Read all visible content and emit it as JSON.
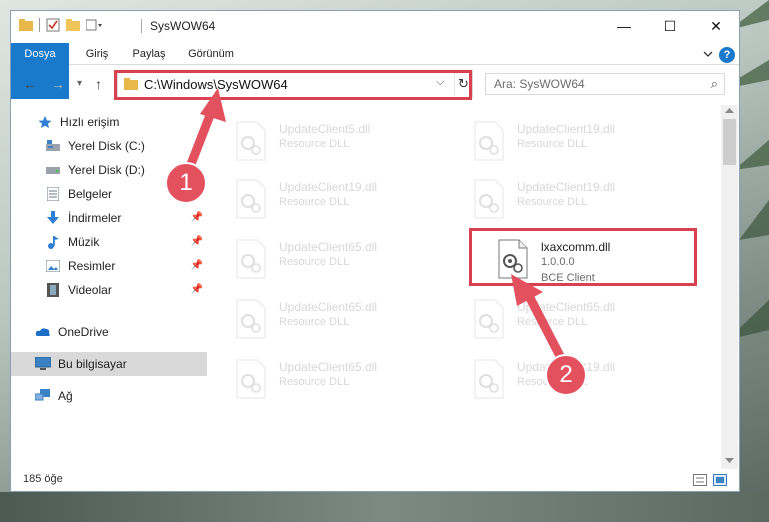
{
  "window": {
    "title": "SysWOW64",
    "controls": {
      "minimize": "—",
      "maximize": "☐",
      "close": "✕"
    }
  },
  "ribbon": {
    "tabs": [
      "Dosya",
      "Giriş",
      "Paylaş",
      "Görünüm"
    ],
    "help": "?"
  },
  "navigation": {
    "back": "←",
    "forward": "→",
    "recent": "▾",
    "up": "↑",
    "address": "C:\\Windows\\SysWOW64",
    "address_dropdown": "⌵",
    "refresh": "↻",
    "search_placeholder": "Ara: SysWOW64",
    "search_icon": "⌕"
  },
  "sidebar": {
    "items": [
      {
        "label": "Hızlı erişim",
        "icon": "star-icon",
        "pinned": false
      },
      {
        "label": "Yerel Disk (C:)",
        "icon": "drive-icon",
        "pinned": false
      },
      {
        "label": "Yerel Disk (D:)",
        "icon": "drive-icon",
        "pinned": false
      },
      {
        "label": "Belgeler",
        "icon": "documents-icon",
        "pinned": false
      },
      {
        "label": "İndirmeler",
        "icon": "download-icon",
        "pinned": true
      },
      {
        "label": "Müzik",
        "icon": "music-icon",
        "pinned": true
      },
      {
        "label": "Resimler",
        "icon": "pictures-icon",
        "pinned": true
      },
      {
        "label": "Videolar",
        "icon": "video-icon",
        "pinned": true
      },
      {
        "label": "OneDrive",
        "icon": "cloud-icon",
        "pinned": false
      },
      {
        "label": "Bu bilgisayar",
        "icon": "computer-icon",
        "pinned": false,
        "selected": true
      },
      {
        "label": "Ağ",
        "icon": "network-icon",
        "pinned": false
      }
    ]
  },
  "files": {
    "faded": [
      {
        "name": "UpdateClient5.dll",
        "type": "Resource DLL"
      },
      {
        "name": "UpdateClient19.dll",
        "type": "Resource DLL"
      },
      {
        "name": "UpdateClient19.dll",
        "type": "Resource DLL"
      },
      {
        "name": "UpdateClient19.dll",
        "type": "Resource DLL"
      },
      {
        "name": "UpdateClient65.dll",
        "type": "Resource DLL"
      },
      {
        "name": "UpdateClient65.dll",
        "type": "Resource DLL"
      },
      {
        "name": "UpdateClient65.dll",
        "type": "Resource DLL"
      },
      {
        "name": "UpdateClient65.dll",
        "type": "Resource DLL"
      },
      {
        "name": "UpdateClient19.dll",
        "type": "Resource DLL"
      }
    ],
    "highlighted": {
      "name": "lxaxcomm.dll",
      "version": "1.0.0.0",
      "company": "BCE Client"
    }
  },
  "status": {
    "item_count": "185 öğe"
  },
  "annotations": {
    "step1": "1",
    "step2": "2"
  },
  "colors": {
    "accent": "#1979ca",
    "highlight": "#d94150",
    "callout": "#e3505e"
  }
}
